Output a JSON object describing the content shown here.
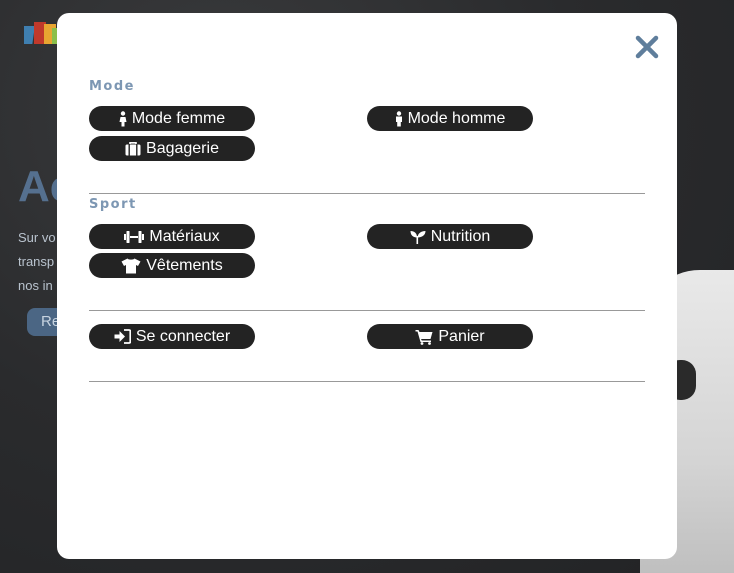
{
  "modal": {
    "close_label": "✕",
    "sections": [
      {
        "title": "Mode",
        "items": [
          {
            "label": "Mode femme",
            "icon": "female-icon"
          },
          {
            "label": "Mode homme",
            "icon": "male-icon"
          },
          {
            "label": "Bagagerie",
            "icon": "suitcase-icon"
          }
        ]
      },
      {
        "title": "Sport",
        "items": [
          {
            "label": "Matériaux",
            "icon": "dumbbell-icon"
          },
          {
            "label": "Nutrition",
            "icon": "seedling-icon"
          },
          {
            "label": "Vêtements",
            "icon": "tshirt-icon"
          }
        ]
      },
      {
        "title": "",
        "items": [
          {
            "label": "Se connecter",
            "icon": "sign-in-icon"
          },
          {
            "label": "Panier",
            "icon": "cart-icon"
          }
        ]
      }
    ]
  },
  "background": {
    "heading_fragment": "Ac",
    "text_lines": [
      "Sur vo",
      "transp",
      "nos in"
    ],
    "button_fragment": "Re"
  },
  "colors": {
    "pill_bg": "#232323",
    "section_title": "#7d97b3",
    "close_icon": "#5f7e9c",
    "overlay_bg": "#2b2c2e"
  }
}
